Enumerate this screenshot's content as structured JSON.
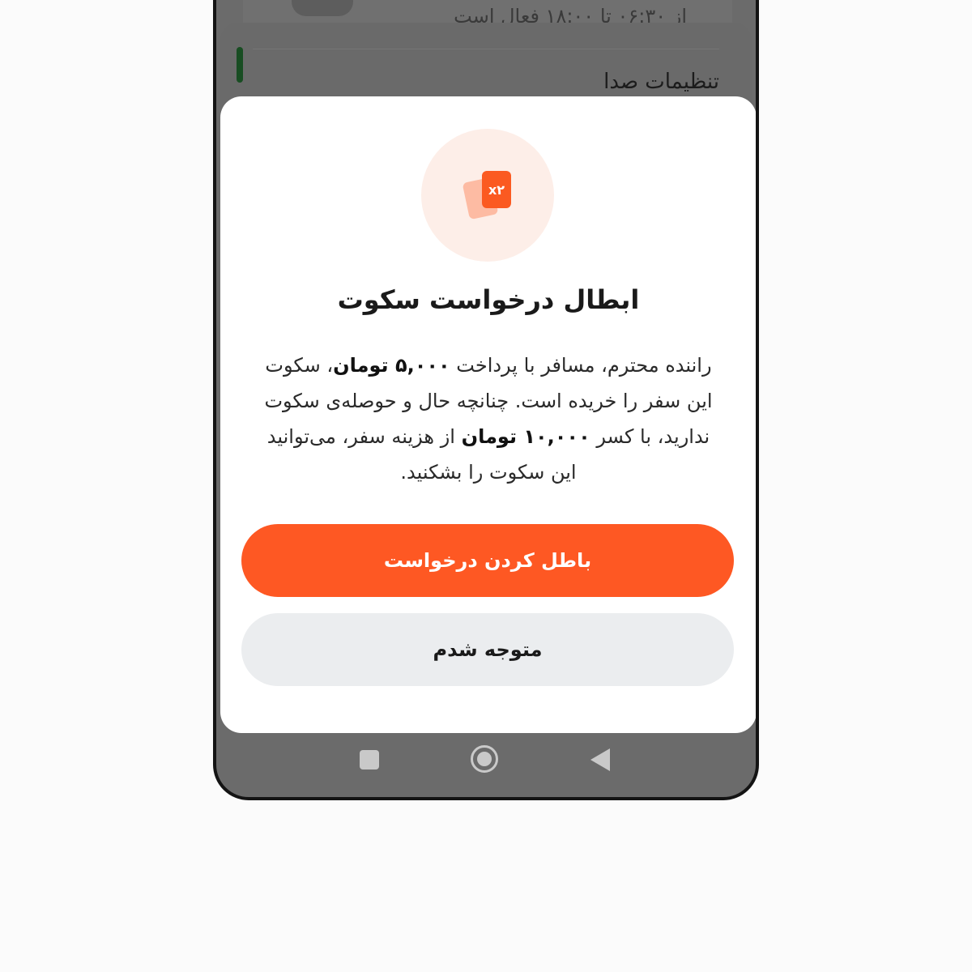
{
  "background": {
    "active_hours": "از ۰۶:۳۰ تا ۱۸:۰۰ فعال است",
    "sound_settings": "تنظیمات صدا"
  },
  "dialog": {
    "icon_badge": "x۲",
    "title": "ابطال درخواست سکوت",
    "body": {
      "p1": "راننده محترم، مسافر با پرداخت ",
      "amount1": "۵,۰۰۰ تومان",
      "p2": "، سکوت این سفر را خریده است. چنانچه حال و حوصله‌ی سکوت ندارید، با کسر ",
      "amount2": "۱۰,۰۰۰ تومان",
      "p3": " از هزینه سفر، می‌توانید این سکوت را بشکنید."
    },
    "primary_button": "باطل کردن درخواست",
    "secondary_button": "متوجه شدم"
  },
  "colors": {
    "accent": "#FE5823",
    "secondary_button_bg": "#EBEDEF",
    "icon_bg": "#FDEEE8"
  },
  "navbar": {
    "icons": [
      "recents-icon",
      "home-icon",
      "back-icon"
    ]
  }
}
